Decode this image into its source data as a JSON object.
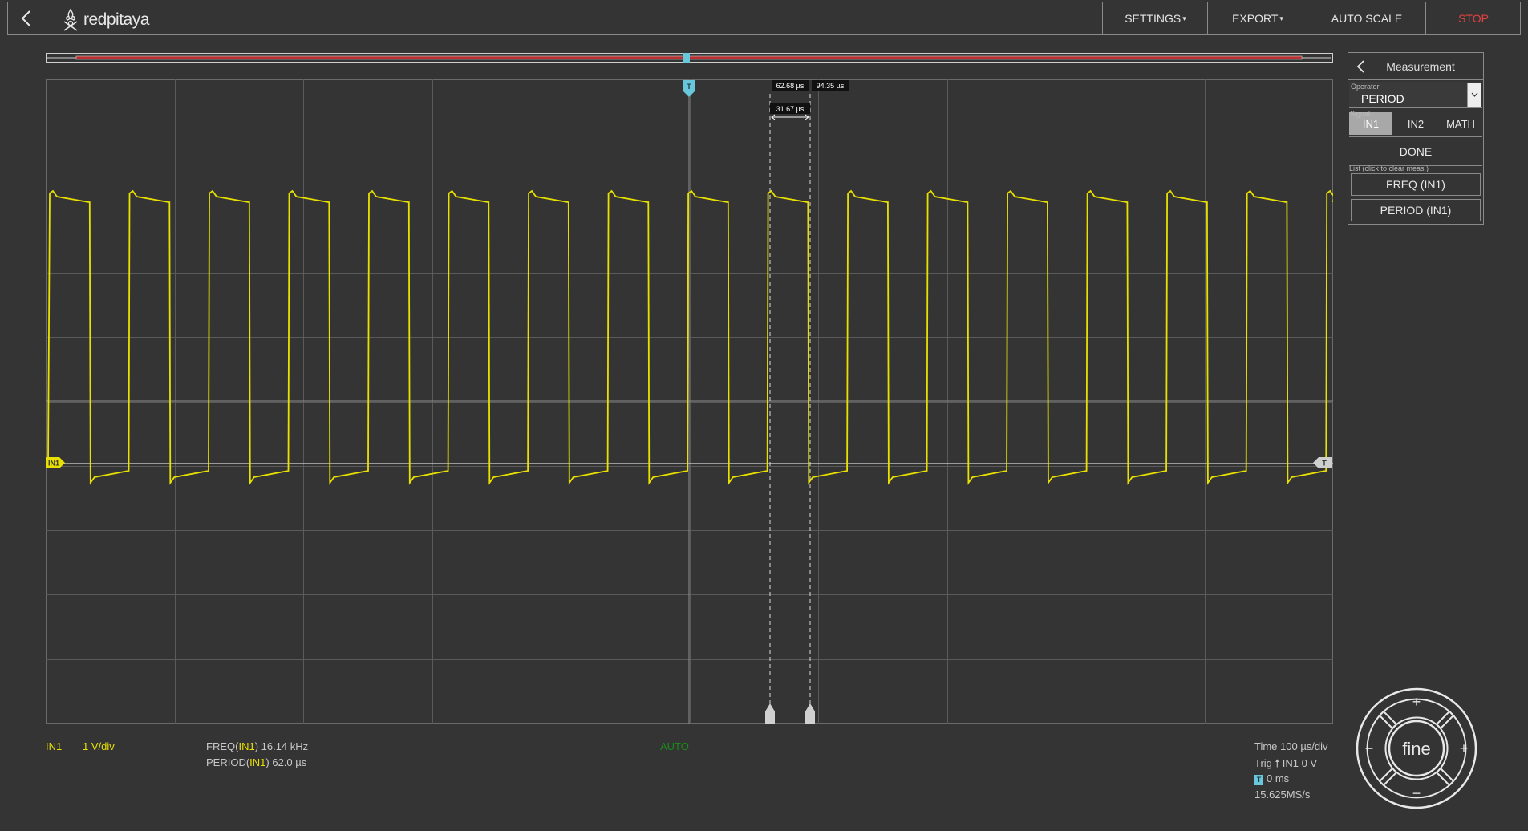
{
  "header": {
    "back_label": "back",
    "logo_text": "redpitaya",
    "menu": {
      "settings": "SETTINGS",
      "export": "EXPORT",
      "autoscale": "AUTO SCALE",
      "stop": "STOP"
    }
  },
  "cursors": {
    "x1_label": "62.68 µs",
    "x2_label": "94.35 µs",
    "delta_label": "31.67 µs"
  },
  "markers": {
    "trigger_label": "T",
    "channel_label": "IN1",
    "trigger_level_label": "T"
  },
  "panel": {
    "title": "Measurement",
    "operator_caption": "Operator",
    "operator_value": "PERIOD",
    "signal_caption": "Signal",
    "signals": [
      "IN1",
      "IN2",
      "MATH"
    ],
    "active_signal": "IN1",
    "done_label": "DONE",
    "list_caption": "List (click to clear meas.)",
    "items": [
      "FREQ (IN1)",
      "PERIOD (IN1)"
    ]
  },
  "footer": {
    "channel": "IN1",
    "scale": "1 V/div",
    "freq_prefix": "FREQ(",
    "freq_channel": "IN1",
    "freq_suffix": ") 16.14 kHz",
    "period_prefix": "PERIOD(",
    "period_channel": "IN1",
    "period_suffix": ") 62.0 µs",
    "trigger_mode": "AUTO",
    "time": "Time 100 µs/div",
    "trig_prefix": "Trig",
    "trig_suffix": "IN1 0 V",
    "offset_badge": "T",
    "offset": "0 ms",
    "sample_rate": "15.625MS/s"
  },
  "joystick": {
    "center": "fine",
    "up": "+",
    "down": "−",
    "left": "−",
    "right": "+"
  },
  "colors": {
    "background": "#343434",
    "signal": "#e8e000",
    "trigger": "#69c7dc",
    "stop": "#e54040",
    "grid": "#5a5a5a"
  },
  "chart_data": {
    "type": "line",
    "series": [
      {
        "name": "IN1",
        "shape": "square wave",
        "period_us": 62.0,
        "frequency_khz": 16.14
      }
    ],
    "x_scale": "100 µs/div",
    "y_scale": "1 V/div",
    "grid": true
  }
}
